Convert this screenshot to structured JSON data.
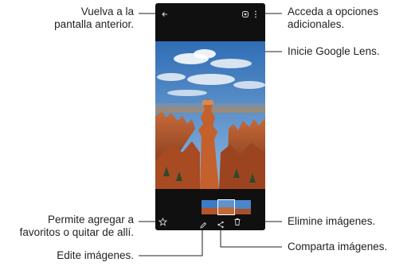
{
  "callouts": {
    "back_line1": "Vuelva a la",
    "back_line2": "pantalla anterior.",
    "options_line1": "Acceda a opciones",
    "options_line2": "adicionales.",
    "lens": "Inicie Google Lens.",
    "favorite_line1": "Permite agregar a",
    "favorite_line2": "favoritos o quitar de allí.",
    "delete": "Elimine imágenes.",
    "share": "Comparta imágenes.",
    "edit": "Edite imágenes."
  },
  "icons": {
    "back": "back-arrow-icon",
    "lens": "google-lens-icon",
    "more": "more-options-icon",
    "favorite": "star-icon",
    "edit": "pencil-icon",
    "share": "share-icon",
    "delete": "trash-icon"
  },
  "colors": {
    "phone": "#101010",
    "sky": "#4a86c8",
    "rock": "#b5552a",
    "leader": "#231f20"
  }
}
